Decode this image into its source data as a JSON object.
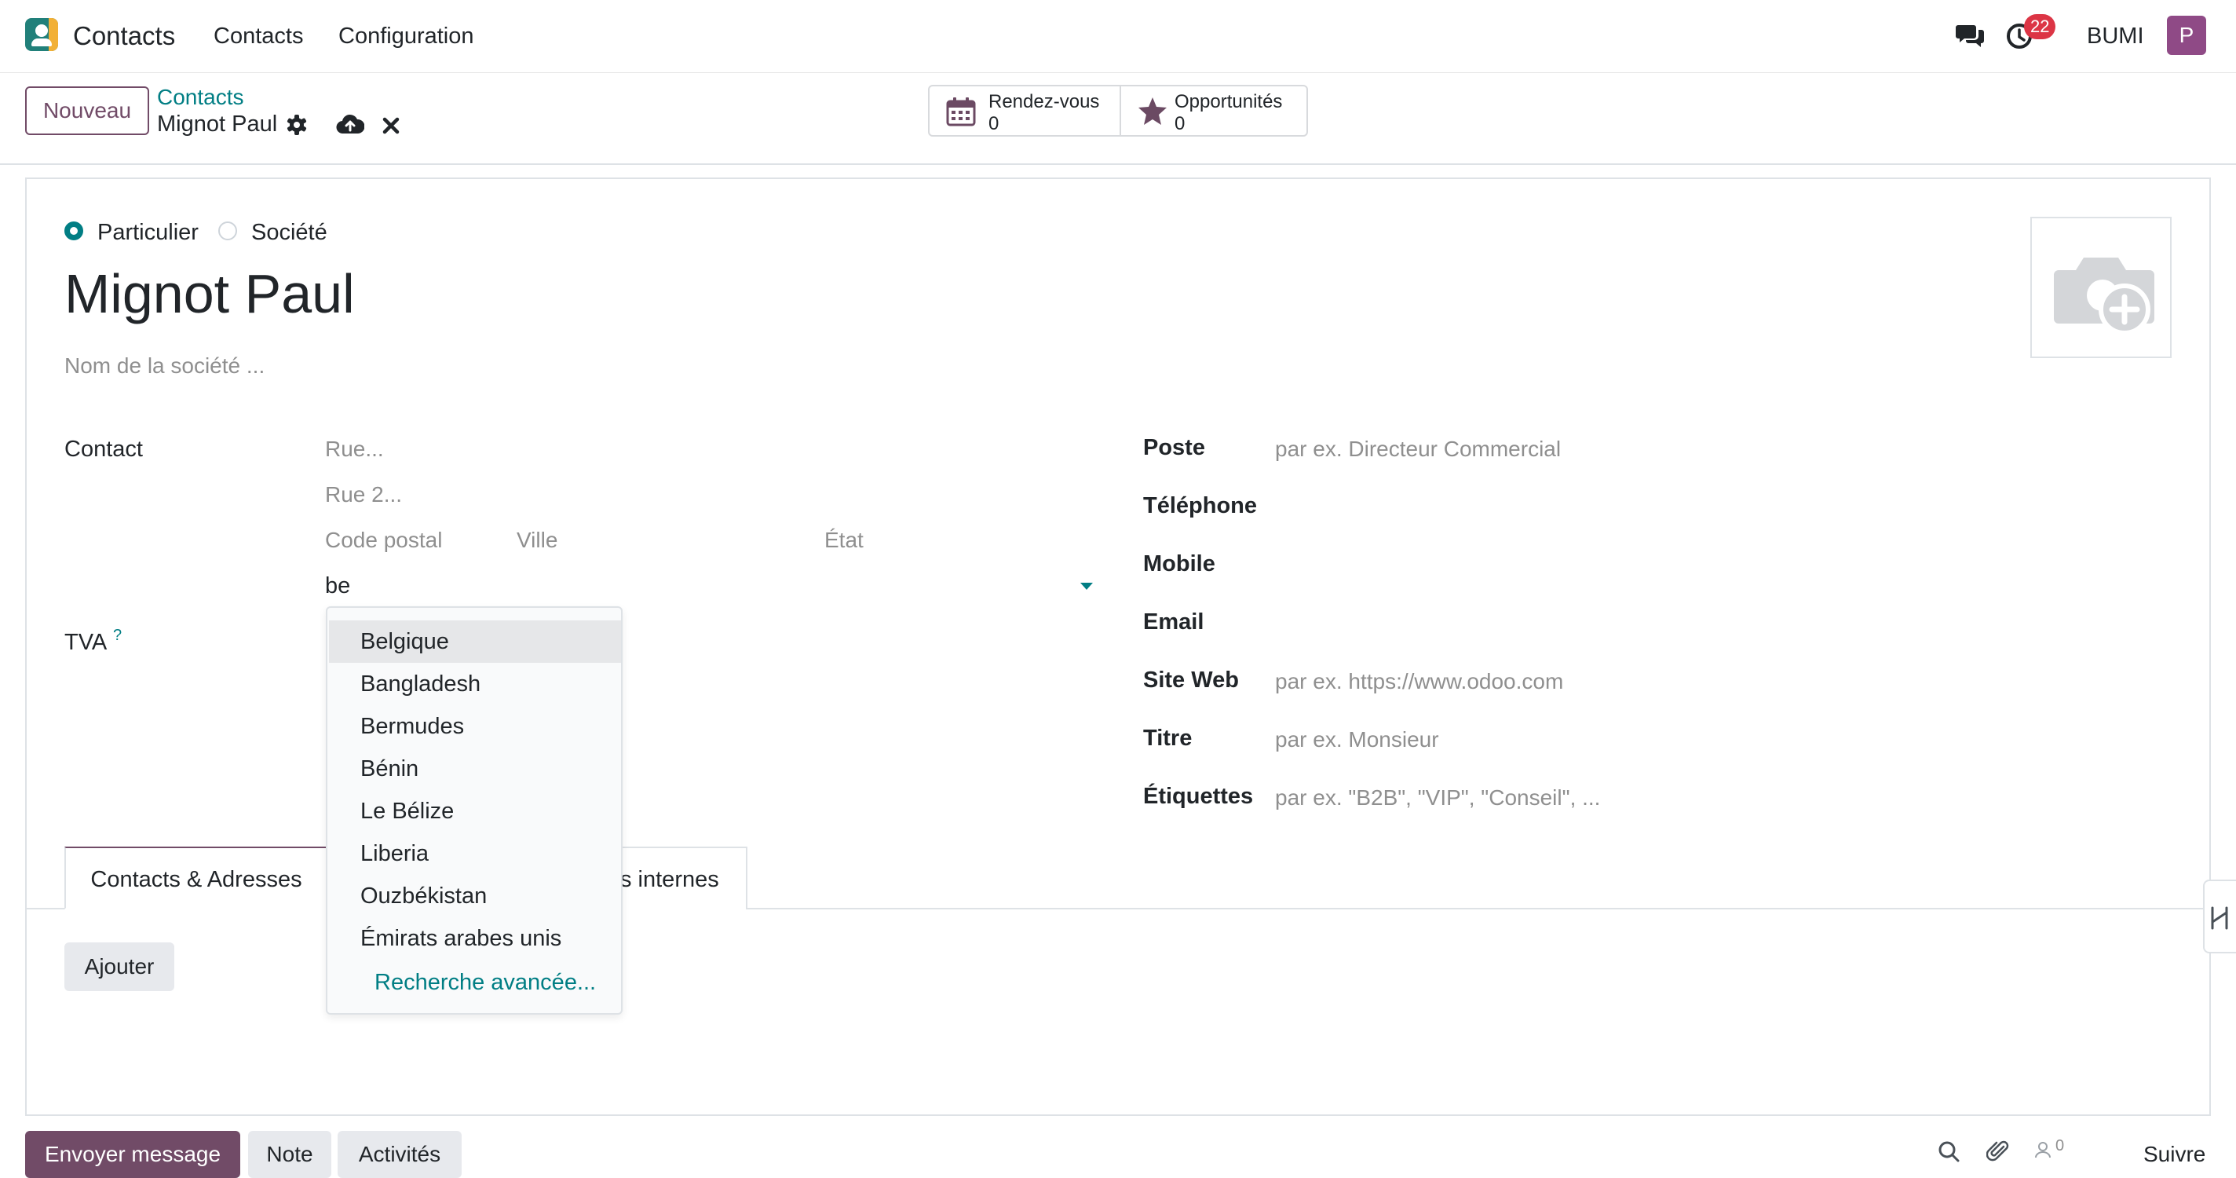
{
  "navbar": {
    "app_name": "Contacts",
    "menu": [
      "Contacts",
      "Configuration"
    ],
    "activity_count": "22",
    "company": "BUMI",
    "user_initial": "P"
  },
  "control_panel": {
    "new_label": "Nouveau",
    "breadcrumb_parent": "Contacts",
    "breadcrumb_current": "Mignot Paul",
    "smart_buttons": [
      {
        "label": "Rendez-vous",
        "value": "0",
        "icon": "calendar-icon"
      },
      {
        "label": "Opportunités",
        "value": "0",
        "icon": "star-icon"
      }
    ]
  },
  "form": {
    "type_options": [
      "Particulier",
      "Société"
    ],
    "selected_type": "Particulier",
    "name": "Mignot Paul",
    "company_placeholder": "Nom de la société ...",
    "left": {
      "contact_label": "Contact",
      "street_placeholder": "Rue...",
      "street2_placeholder": "Rue 2...",
      "zip_placeholder": "Code postal",
      "city_placeholder": "Ville",
      "state_placeholder": "État",
      "country_value": "be",
      "vat_label": "TVA",
      "vat_help": "?"
    },
    "right": {
      "job_label": "Poste",
      "job_placeholder": "par ex. Directeur Commercial",
      "phone_label": "Téléphone",
      "mobile_label": "Mobile",
      "email_label": "Email",
      "website_label": "Site Web",
      "website_placeholder": "par ex. https://www.odoo.com",
      "title_label": "Titre",
      "title_placeholder": "par ex. Monsieur",
      "tags_label": "Étiquettes",
      "tags_placeholder": "par ex. \"B2B\", \"VIP\", \"Conseil\", ..."
    },
    "tabs": {
      "active": "Contacts & Adresses",
      "other_visible": "s internes"
    },
    "add_label": "Ajouter"
  },
  "dropdown": {
    "items": [
      "Belgique",
      "Bangladesh",
      "Bermudes",
      "Bénin",
      "Le Bélize",
      "Liberia",
      "Ouzbékistan",
      "Émirats arabes unis"
    ],
    "advanced": "Recherche avancée..."
  },
  "chatter": {
    "send": "Envoyer message",
    "note": "Note",
    "activities": "Activités",
    "followers_count": "0",
    "follow": "Suivre"
  },
  "colors": {
    "brand": "#714b67",
    "accent": "#017e84",
    "badge": "#dc3545"
  }
}
